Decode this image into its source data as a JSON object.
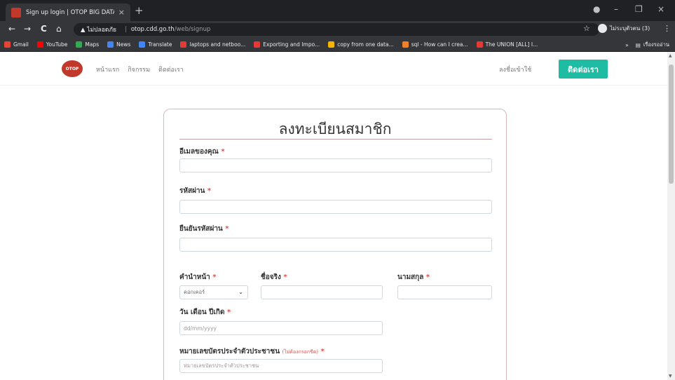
{
  "browser": {
    "tab_title": "Sign up login | OTOP BIG DATA",
    "tab_close": "×",
    "new_tab": "+",
    "window_controls": [
      "●",
      "–",
      "❐",
      "×"
    ],
    "nav_icons": [
      "←",
      "→",
      "C",
      "⌂"
    ],
    "security_text": "▲ ไม่ปลอดภัย",
    "url_host": "otop.cdd.go.th",
    "url_path": "/web/signup",
    "profile_label": "ไม่ระบุตัวตน (3)",
    "bookmarks": [
      {
        "label": "Gmail",
        "color": "#ea4335"
      },
      {
        "label": "YouTube",
        "color": "#ff0000"
      },
      {
        "label": "Maps",
        "color": "#34a853"
      },
      {
        "label": "News",
        "color": "#4285f4"
      },
      {
        "label": "Translate",
        "color": "#4285f4"
      },
      {
        "label": "laptops and netboo...",
        "color": "#e53935"
      },
      {
        "label": "Exporting and Impo...",
        "color": "#e53935"
      },
      {
        "label": "copy from one data...",
        "color": "#f4b400"
      },
      {
        "label": "sql - How can I crea...",
        "color": "#f48024"
      },
      {
        "label": "The UNION [ALL] I...",
        "color": "#e53935"
      }
    ],
    "bookmarks_more": "»",
    "reading_list": "เรื่องรออ่าน"
  },
  "site": {
    "logo_text": "OTOP",
    "nav": [
      "หน้าแรก",
      "กิจกรรม",
      "ติดต่อเรา"
    ],
    "login_link": "ลงชื่อเข้าใช้",
    "contact_button": "ติดต่อเรา",
    "accent_color": "#1fbca4"
  },
  "form": {
    "title": "ลงทะเบียนสมาชิก",
    "required_mark": "*",
    "email_label": "อีเมลของคุณ",
    "password_label": "รหัสผ่าน",
    "confirm_label": "ยืนยันรหัสผ่าน",
    "prefix_label": "คำนำหน้า",
    "prefix_value": "คอกเคอร์",
    "firstname_label": "ชื่อจริง",
    "lastname_label": "นามสกุล",
    "dob_label": "วัน เดือน ปีเกิด",
    "dob_placeholder": "dd/mm/yyyy",
    "idcard_label": "หมายเลขบัตรประจำตัวประชาชน",
    "idcard_hint": "(ไม่ต้องกรอกขีด)",
    "idcard_placeholder": "หมายเลขบัตรประจำตัวประชาชน"
  }
}
